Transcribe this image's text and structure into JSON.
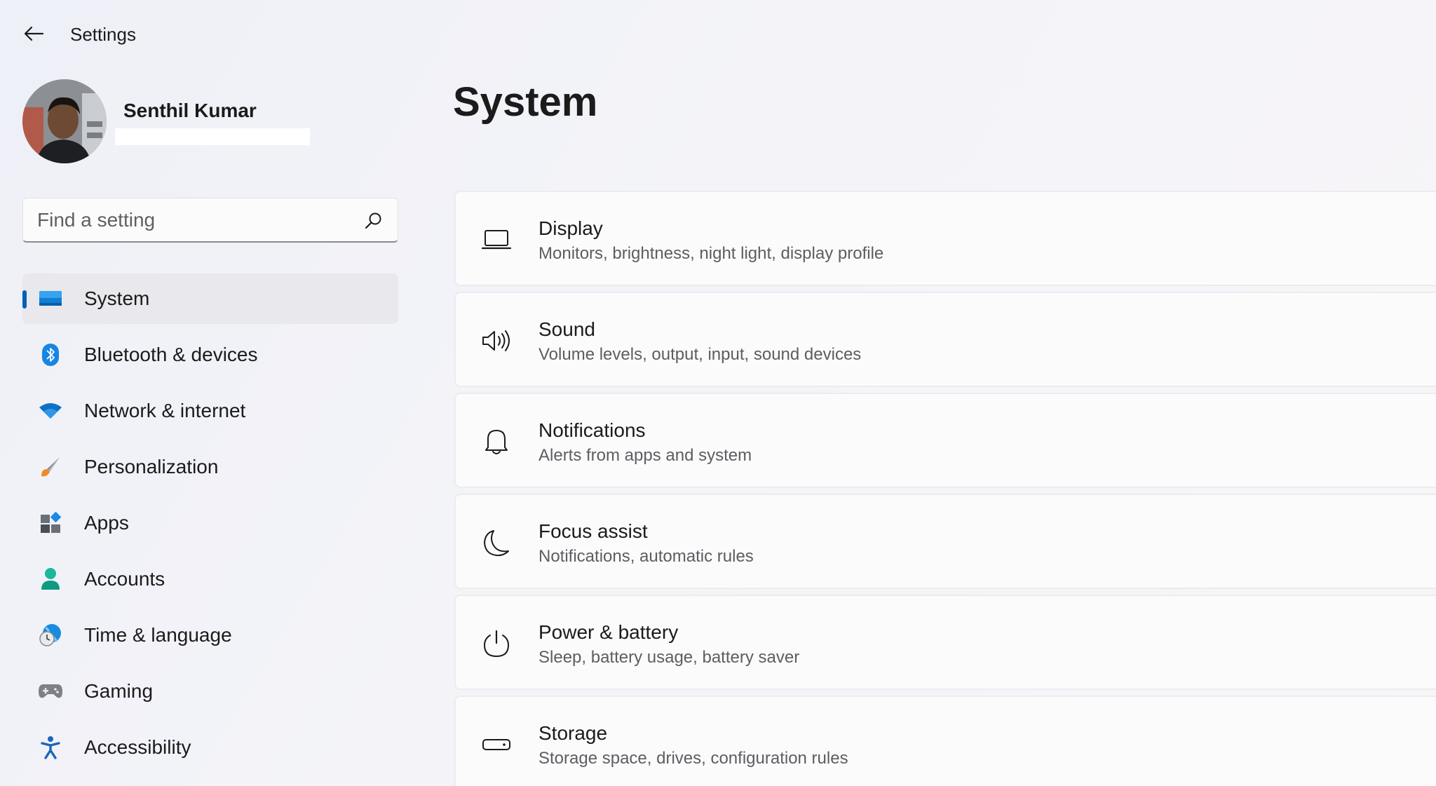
{
  "window": {
    "title": "Settings"
  },
  "profile": {
    "name": "Senthil Kumar"
  },
  "search": {
    "placeholder": "Find a setting"
  },
  "sidebar": {
    "items": [
      {
        "label": "System",
        "icon": "system-icon",
        "active": true
      },
      {
        "label": "Bluetooth & devices",
        "icon": "bluetooth-icon"
      },
      {
        "label": "Network & internet",
        "icon": "wifi-icon"
      },
      {
        "label": "Personalization",
        "icon": "brush-icon"
      },
      {
        "label": "Apps",
        "icon": "apps-icon"
      },
      {
        "label": "Accounts",
        "icon": "person-icon"
      },
      {
        "label": "Time & language",
        "icon": "globe-clock-icon"
      },
      {
        "label": "Gaming",
        "icon": "gamepad-icon"
      },
      {
        "label": "Accessibility",
        "icon": "accessibility-icon"
      }
    ]
  },
  "main": {
    "title": "System",
    "cards": [
      {
        "title": "Display",
        "subtitle": "Monitors, brightness, night light, display profile",
        "icon": "laptop-icon"
      },
      {
        "title": "Sound",
        "subtitle": "Volume levels, output, input, sound devices",
        "icon": "speaker-icon"
      },
      {
        "title": "Notifications",
        "subtitle": "Alerts from apps and system",
        "icon": "bell-icon"
      },
      {
        "title": "Focus assist",
        "subtitle": "Notifications, automatic rules",
        "icon": "moon-icon"
      },
      {
        "title": "Power & battery",
        "subtitle": "Sleep, battery usage, battery saver",
        "icon": "power-icon"
      },
      {
        "title": "Storage",
        "subtitle": "Storage space, drives, configuration rules",
        "icon": "storage-icon"
      }
    ]
  },
  "colors": {
    "accent": "#005fb8",
    "background": "#f3f3f6",
    "card": "#fbfbfc"
  }
}
